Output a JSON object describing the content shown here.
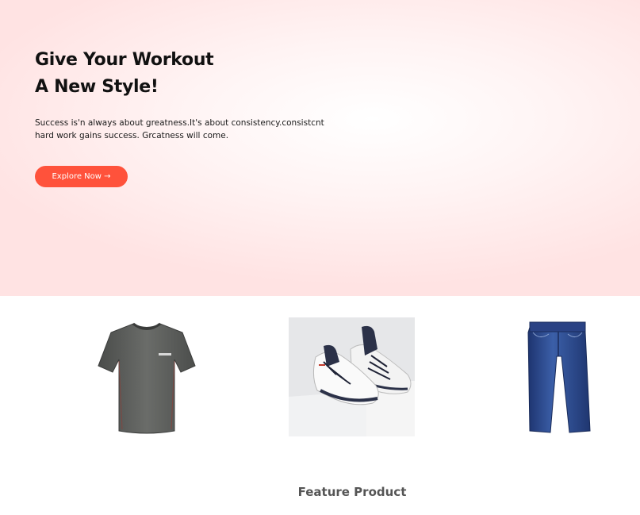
{
  "hero": {
    "title_line1": "Give Your Workout",
    "title_line2": "A New Style!",
    "text_line1": "Success is'n always about greatness.It's about consistency.consistcnt",
    "text_line2": "hard work gains success. Grcatness will come.",
    "button_label": "Explore Now →",
    "accent_color": "#ff523b",
    "background_tint": "#ffe3e3"
  },
  "products": [
    {
      "name": "gray-tshirt",
      "icon": "tshirt-image"
    },
    {
      "name": "white-sneakers",
      "icon": "sneakers-image"
    },
    {
      "name": "blue-jeans",
      "icon": "jeans-image"
    }
  ],
  "section": {
    "title": "Feature Product"
  }
}
